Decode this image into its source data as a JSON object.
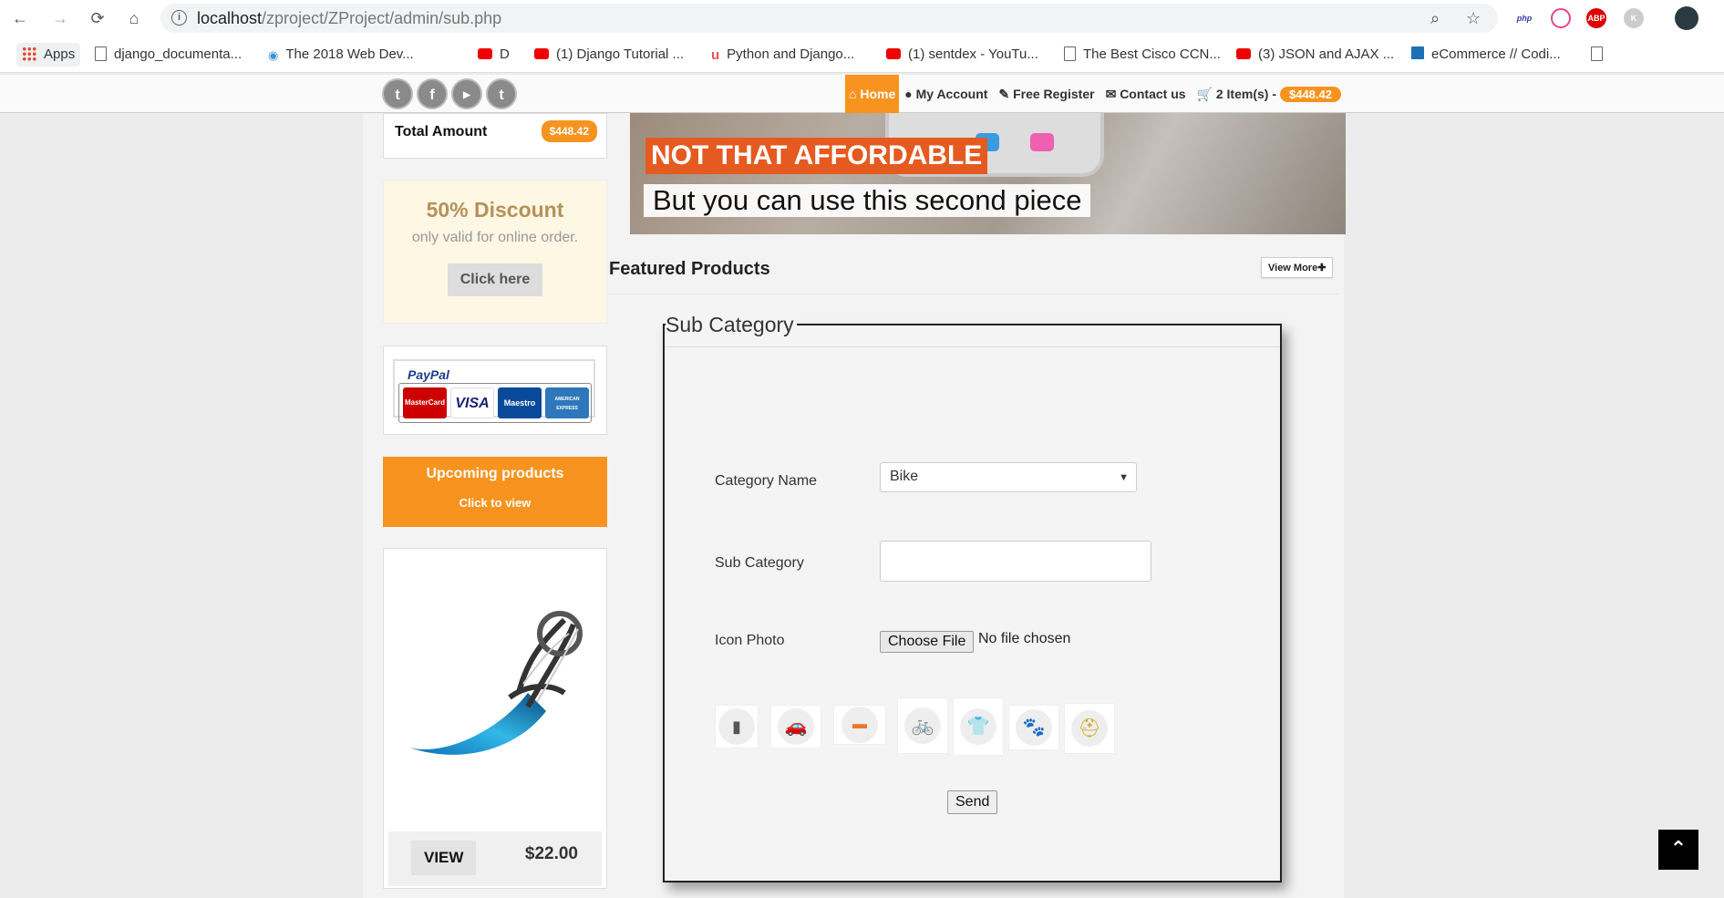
{
  "browser": {
    "url_host": "localhost",
    "url_path": "/zproject/ZProject/admin/sub.php",
    "bookmarks": [
      {
        "label": "Apps",
        "icon": "apps-grid-icon"
      },
      {
        "label": "django_documenta...",
        "icon": "document-icon"
      },
      {
        "label": "The 2018 Web Dev...",
        "icon": "eye-icon"
      },
      {
        "label": "D",
        "icon": "youtube-icon"
      },
      {
        "label": "(1) Django Tutorial ...",
        "icon": "youtube-icon"
      },
      {
        "label": "Python and Django...",
        "icon": "udemy-icon"
      },
      {
        "label": "(1) sentdex - YouTu...",
        "icon": "youtube-icon"
      },
      {
        "label": "The Best Cisco CCN...",
        "icon": "document-icon"
      },
      {
        "label": "(3) JSON and AJAX ...",
        "icon": "youtube-icon"
      },
      {
        "label": "eCommerce // Codi...",
        "icon": "codi-icon"
      }
    ],
    "extensions": [
      "php",
      "ABP",
      "K"
    ],
    "colors": {
      "youtube": "#e00000",
      "accent": "#f7931e"
    }
  },
  "header": {
    "social": [
      "twitter-icon",
      "facebook-icon",
      "youtube-icon",
      "tumblr-icon"
    ],
    "nav": {
      "home": "Home",
      "account": "My Account",
      "register": "Free Register",
      "contact": "Contact us",
      "cart": "2 Item(s) -",
      "cart_total": "$448.42"
    }
  },
  "sidebar": {
    "total_label": "Total Amount",
    "total_value": "$448.42",
    "discount_title": "50% Discount",
    "discount_sub": "only valid for online order.",
    "discount_button": "Click here",
    "paypal": "PayPal",
    "cards": [
      "MasterCard",
      "VISA",
      "Maestro",
      "AMERICAN EXPRESS"
    ],
    "upcoming_title": "Upcoming products",
    "upcoming_sub": "Click to view",
    "product_view": "VIEW",
    "product_price": "$22.00"
  },
  "banner": {
    "title": "NOT THAT AFFORDABLE",
    "subtitle": "But you can use this second piece"
  },
  "featured": {
    "title": "Featured Products",
    "view_more": "View More"
  },
  "form": {
    "legend": "Sub Category",
    "category_label": "Category Name",
    "category_value": "Bike",
    "subcategory_label": "Sub Category",
    "subcategory_value": "",
    "icon_label": "Icon Photo",
    "file_button": "Choose File",
    "file_status": "No file chosen",
    "icons": [
      {
        "name": "mobile-icon",
        "glyph": "▮"
      },
      {
        "name": "car-icon",
        "glyph": "🚗"
      },
      {
        "name": "monitor-icon",
        "glyph": "▬"
      },
      {
        "name": "bicycle-icon",
        "glyph": "🚲"
      },
      {
        "name": "shirt-icon",
        "glyph": "👕"
      },
      {
        "name": "paw-icon",
        "glyph": "🐾"
      },
      {
        "name": "helmet-icon",
        "glyph": "⛑"
      }
    ],
    "send_button": "Send"
  }
}
